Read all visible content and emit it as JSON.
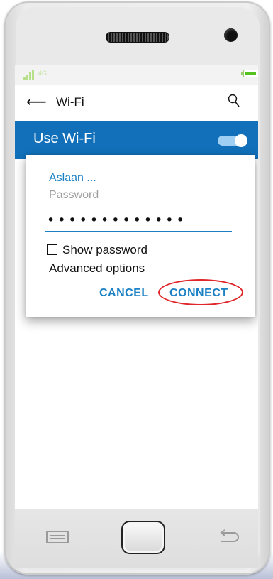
{
  "status_bar": {
    "network_label": "4G",
    "battery_text": "",
    "battery_level": 0.85,
    "signal_color": "#b7e08a",
    "battery_color": "#55c21f"
  },
  "app_bar": {
    "back_icon": "back-arrow-icon",
    "back_glyph": "⟵",
    "title": "Wi-Fi",
    "search_icon": "search-icon"
  },
  "wifi_bar": {
    "label": "Use Wi-Fi",
    "toggle_on": true,
    "background_color": "#1170b9"
  },
  "dialog": {
    "network_name": "Aslaan ...",
    "password_placeholder": "Password",
    "password_value": "•••••••••••••",
    "show_password_label": "Show password",
    "show_password_checked": false,
    "advanced_options_label": "Advanced options",
    "cancel_label": "CANCEL",
    "connect_label": "CONNECT",
    "accent_color": "#1b80c4",
    "highlight_color": "#e0262a"
  },
  "nav_bar": {
    "menu_icon": "menu-icon",
    "home_icon": "home-button",
    "back_icon": "back-icon"
  }
}
